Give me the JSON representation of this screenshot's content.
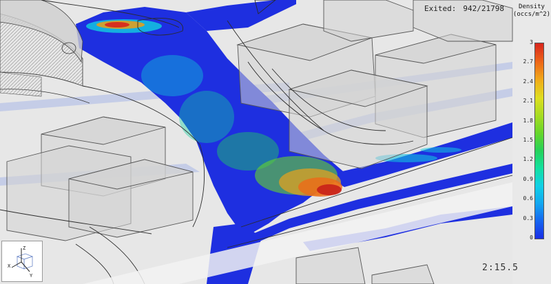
{
  "status": {
    "exited_label": "Exited:",
    "exited_value": "942/21798"
  },
  "legend": {
    "title_line1": "Density",
    "title_line2": "(occs/m^2)",
    "ticks": [
      "3",
      "2.7",
      "2.4",
      "2.1",
      "1.8",
      "1.5",
      "1.2",
      "0.9",
      "0.6",
      "0.3",
      "0"
    ],
    "min": 0,
    "max": 3
  },
  "axes": {
    "z": "Z",
    "x": "X",
    "y": "Y"
  },
  "timer": "2:15.5",
  "colors": {
    "walkway": "#1e2fe0",
    "low": "#1a2ee6",
    "high": "#d8241c"
  }
}
